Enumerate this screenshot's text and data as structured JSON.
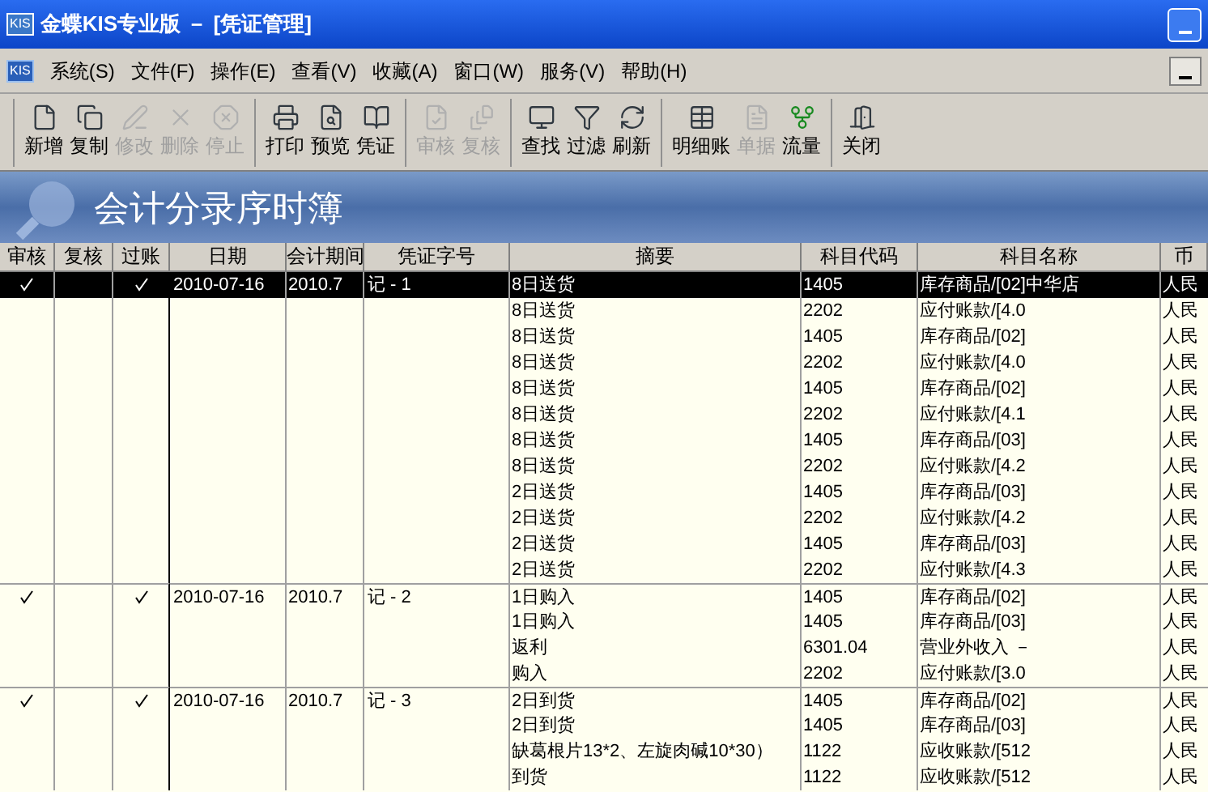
{
  "window": {
    "title": "金蝶KIS专业版 － [凭证管理]",
    "logo": "KIS"
  },
  "menu_logo": "KIS",
  "menu": [
    "系统(S)",
    "文件(F)",
    "操作(E)",
    "查看(V)",
    "收藏(A)",
    "窗口(W)",
    "服务(V)",
    "帮助(H)"
  ],
  "toolbar": [
    [
      {
        "kind": "new",
        "label": "新增",
        "disabled": false
      },
      {
        "kind": "copy",
        "label": "复制",
        "disabled": false
      },
      {
        "kind": "edit",
        "label": "修改",
        "disabled": true
      },
      {
        "kind": "delete",
        "label": "删除",
        "disabled": true
      },
      {
        "kind": "stop",
        "label": "停止",
        "disabled": true
      }
    ],
    [
      {
        "kind": "print",
        "label": "打印",
        "disabled": false
      },
      {
        "kind": "preview",
        "label": "预览",
        "disabled": false
      },
      {
        "kind": "voucher",
        "label": "凭证",
        "disabled": false
      }
    ],
    [
      {
        "kind": "audit",
        "label": "审核",
        "disabled": true
      },
      {
        "kind": "review",
        "label": "复核",
        "disabled": true
      }
    ],
    [
      {
        "kind": "find",
        "label": "查找",
        "disabled": false
      },
      {
        "kind": "filter",
        "label": "过滤",
        "disabled": false
      },
      {
        "kind": "refresh",
        "label": "刷新",
        "disabled": false
      }
    ],
    [
      {
        "kind": "ledger",
        "label": "明细账",
        "disabled": false
      },
      {
        "kind": "document",
        "label": "单据",
        "disabled": true
      },
      {
        "kind": "flow",
        "label": "流量",
        "disabled": false
      }
    ],
    [
      {
        "kind": "close",
        "label": "关闭",
        "disabled": false
      }
    ]
  ],
  "banner": {
    "title": "会计分录序时簿"
  },
  "table": {
    "columns": [
      "审核",
      "复核",
      "过账",
      "日期",
      "会计期间",
      "凭证字号",
      "摘要",
      "科目代码",
      "科目名称",
      "币"
    ],
    "vouchers": [
      {
        "audited": true,
        "reviewed": false,
        "posted": true,
        "date": "2010-07-16",
        "period": "2010.7",
        "number": "记 - 1",
        "selected": true,
        "entries": [
          {
            "summary": "8日送货",
            "code": "1405",
            "account": "库存商品/[02]中华店",
            "currency": "人民"
          },
          {
            "summary": "8日送货",
            "code": "2202",
            "account": "应付账款/[4.0",
            "currency": "人民"
          },
          {
            "summary": "8日送货",
            "code": "1405",
            "account": "库存商品/[02]",
            "currency": "人民"
          },
          {
            "summary": "8日送货",
            "code": "2202",
            "account": "应付账款/[4.0",
            "currency": "人民"
          },
          {
            "summary": "8日送货",
            "code": "1405",
            "account": "库存商品/[02]",
            "currency": "人民"
          },
          {
            "summary": "8日送货",
            "code": "2202",
            "account": "应付账款/[4.1",
            "currency": "人民"
          },
          {
            "summary": "8日送货",
            "code": "1405",
            "account": "库存商品/[03]",
            "currency": "人民"
          },
          {
            "summary": "8日送货",
            "code": "2202",
            "account": "应付账款/[4.2",
            "currency": "人民"
          },
          {
            "summary": "2日送货",
            "code": "1405",
            "account": "库存商品/[03]",
            "currency": "人民"
          },
          {
            "summary": "2日送货",
            "code": "2202",
            "account": "应付账款/[4.2",
            "currency": "人民"
          },
          {
            "summary": "2日送货",
            "code": "1405",
            "account": "库存商品/[03]",
            "currency": "人民"
          },
          {
            "summary": "2日送货",
            "code": "2202",
            "account": "应付账款/[4.3",
            "currency": "人民"
          }
        ]
      },
      {
        "audited": true,
        "reviewed": false,
        "posted": true,
        "date": "2010-07-16",
        "period": "2010.7",
        "number": "记 - 2",
        "selected": false,
        "entries": [
          {
            "summary": "1日购入",
            "code": "1405",
            "account": "库存商品/[02]",
            "currency": "人民"
          },
          {
            "summary": "1日购入",
            "code": "1405",
            "account": "库存商品/[03]",
            "currency": "人民"
          },
          {
            "summary": "返利",
            "code": "6301.04",
            "account": "营业外收入 －",
            "currency": "人民"
          },
          {
            "summary": "购入",
            "code": "2202",
            "account": "应付账款/[3.0",
            "currency": "人民"
          }
        ]
      },
      {
        "audited": true,
        "reviewed": false,
        "posted": true,
        "date": "2010-07-16",
        "period": "2010.7",
        "number": "记 - 3",
        "selected": false,
        "entries": [
          {
            "summary": "2日到货",
            "code": "1405",
            "account": "库存商品/[02]",
            "currency": "人民"
          },
          {
            "summary": "2日到货",
            "code": "1405",
            "account": "库存商品/[03]",
            "currency": "人民"
          },
          {
            "summary": "缺葛根片13*2、左旋肉碱10*30）",
            "code": "1122",
            "account": "应收账款/[512",
            "currency": "人民"
          },
          {
            "summary": "到货",
            "code": "1122",
            "account": "应收账款/[512",
            "currency": "人民"
          }
        ]
      }
    ]
  }
}
